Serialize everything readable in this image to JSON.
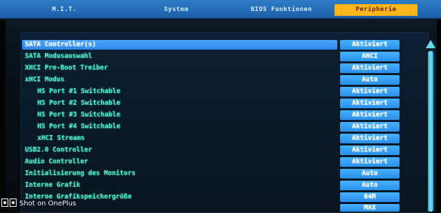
{
  "tabs": [
    {
      "label": "M.I.T."
    },
    {
      "label": "System"
    },
    {
      "label": "BIOS Funktionen"
    },
    {
      "label": "Peripherie"
    }
  ],
  "settings": [
    {
      "label": "SATA Controller(s)",
      "value": "Aktiviert"
    },
    {
      "label": "SATA Modusauswahl",
      "value": "AHCI"
    },
    {
      "label": "XHCI Pre-Boot Treiber",
      "value": "Aktiviert"
    },
    {
      "label": "xHCI Modus",
      "value": "Auto"
    },
    {
      "label": "HS Port #1 Switchable",
      "value": "Aktiviert"
    },
    {
      "label": "HS Port #2 Switchable",
      "value": "Aktiviert"
    },
    {
      "label": "HS Port #3 Switchable",
      "value": "Aktiviert"
    },
    {
      "label": "HS Port #4 Switchable",
      "value": "Aktiviert"
    },
    {
      "label": "xHCI Streams",
      "value": "Aktiviert"
    },
    {
      "label": "USB2.0 Controller",
      "value": "Aktiviert"
    },
    {
      "label": "Audio Controller",
      "value": "Aktiviert"
    },
    {
      "label": "Initialisierung des Monitors",
      "value": "Auto"
    },
    {
      "label": "Interne Grafik",
      "value": "Auto"
    },
    {
      "label": "Interne Grafikspeichergröße",
      "value": "64M"
    },
    {
      "label": "",
      "value": "MAX"
    }
  ],
  "watermark": {
    "text": "Shot on OnePlus"
  },
  "colors": {
    "tabbar": "#1d5fa8",
    "active_tab": "#ffb61b",
    "selected_row": "#2f86e6",
    "value_box": "#2a8ee8",
    "label_text": "#4ef0c8"
  }
}
